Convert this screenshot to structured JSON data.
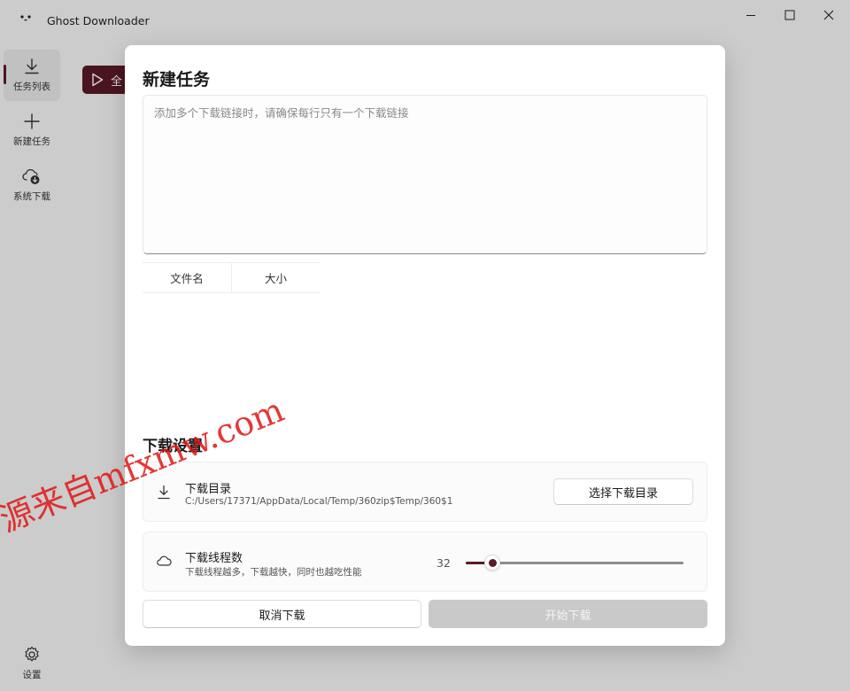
{
  "window": {
    "title": "Ghost Downloader"
  },
  "sidebar": {
    "items": [
      {
        "label": "任务列表",
        "icon": "download-icon",
        "active": true
      },
      {
        "label": "新建任务",
        "icon": "plus-icon",
        "active": false
      },
      {
        "label": "系统下载",
        "icon": "cloud-download-icon",
        "active": false
      }
    ],
    "settings_label": "设置"
  },
  "background": {
    "start_all_label": "全"
  },
  "dialog": {
    "title": "新建任务",
    "url_input_placeholder": "添加多个下载链接时，请确保每行只有一个下载链接",
    "url_input_value": "",
    "table_headers": [
      "文件名",
      "大小"
    ],
    "settings_title": "下载设置",
    "download_dir": {
      "title": "下载目录",
      "path": "C:/Users/17371/AppData/Local/Temp/360zip$Temp/360$1",
      "button_label": "选择下载目录"
    },
    "threads": {
      "title": "下载线程数",
      "description": "下载线程越多，下载越快，同时也越吃性能",
      "value_label": "32",
      "value": 32,
      "slider_fraction": 0.12
    },
    "cancel_label": "取消下载",
    "start_label": "开始下载"
  },
  "watermark": "源来自mfxmw.com",
  "colors": {
    "accent": "#5a1a26",
    "disabled_button": "#c9c9c9",
    "watermark": "#e11414"
  }
}
